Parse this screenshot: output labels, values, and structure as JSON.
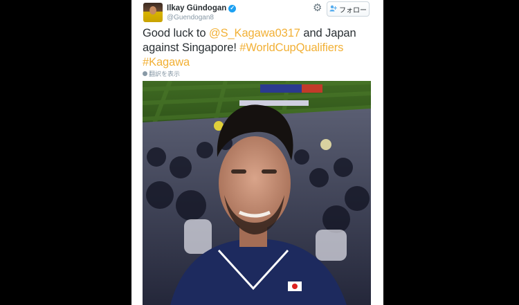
{
  "tweet": {
    "user": {
      "name": "Ilkay Gündogan",
      "handle": "@Guendogan8",
      "verified": true
    },
    "follow_label": "フォロー",
    "text": {
      "p1": "Good luck to ",
      "mention": "@S_Kagawa0317",
      "p2": " and Japan against Singapore! ",
      "hashtag1": "#WorldCupQualifiers",
      "p3": " ",
      "hashtag2": "#Kagawa"
    },
    "translate_label": "翻訳を表示",
    "link_color": "#f2b035",
    "icons": {
      "settings": "gear-icon",
      "follow": "add-user-icon",
      "verified": "verified-badge-icon",
      "translate": "globe-icon"
    }
  }
}
